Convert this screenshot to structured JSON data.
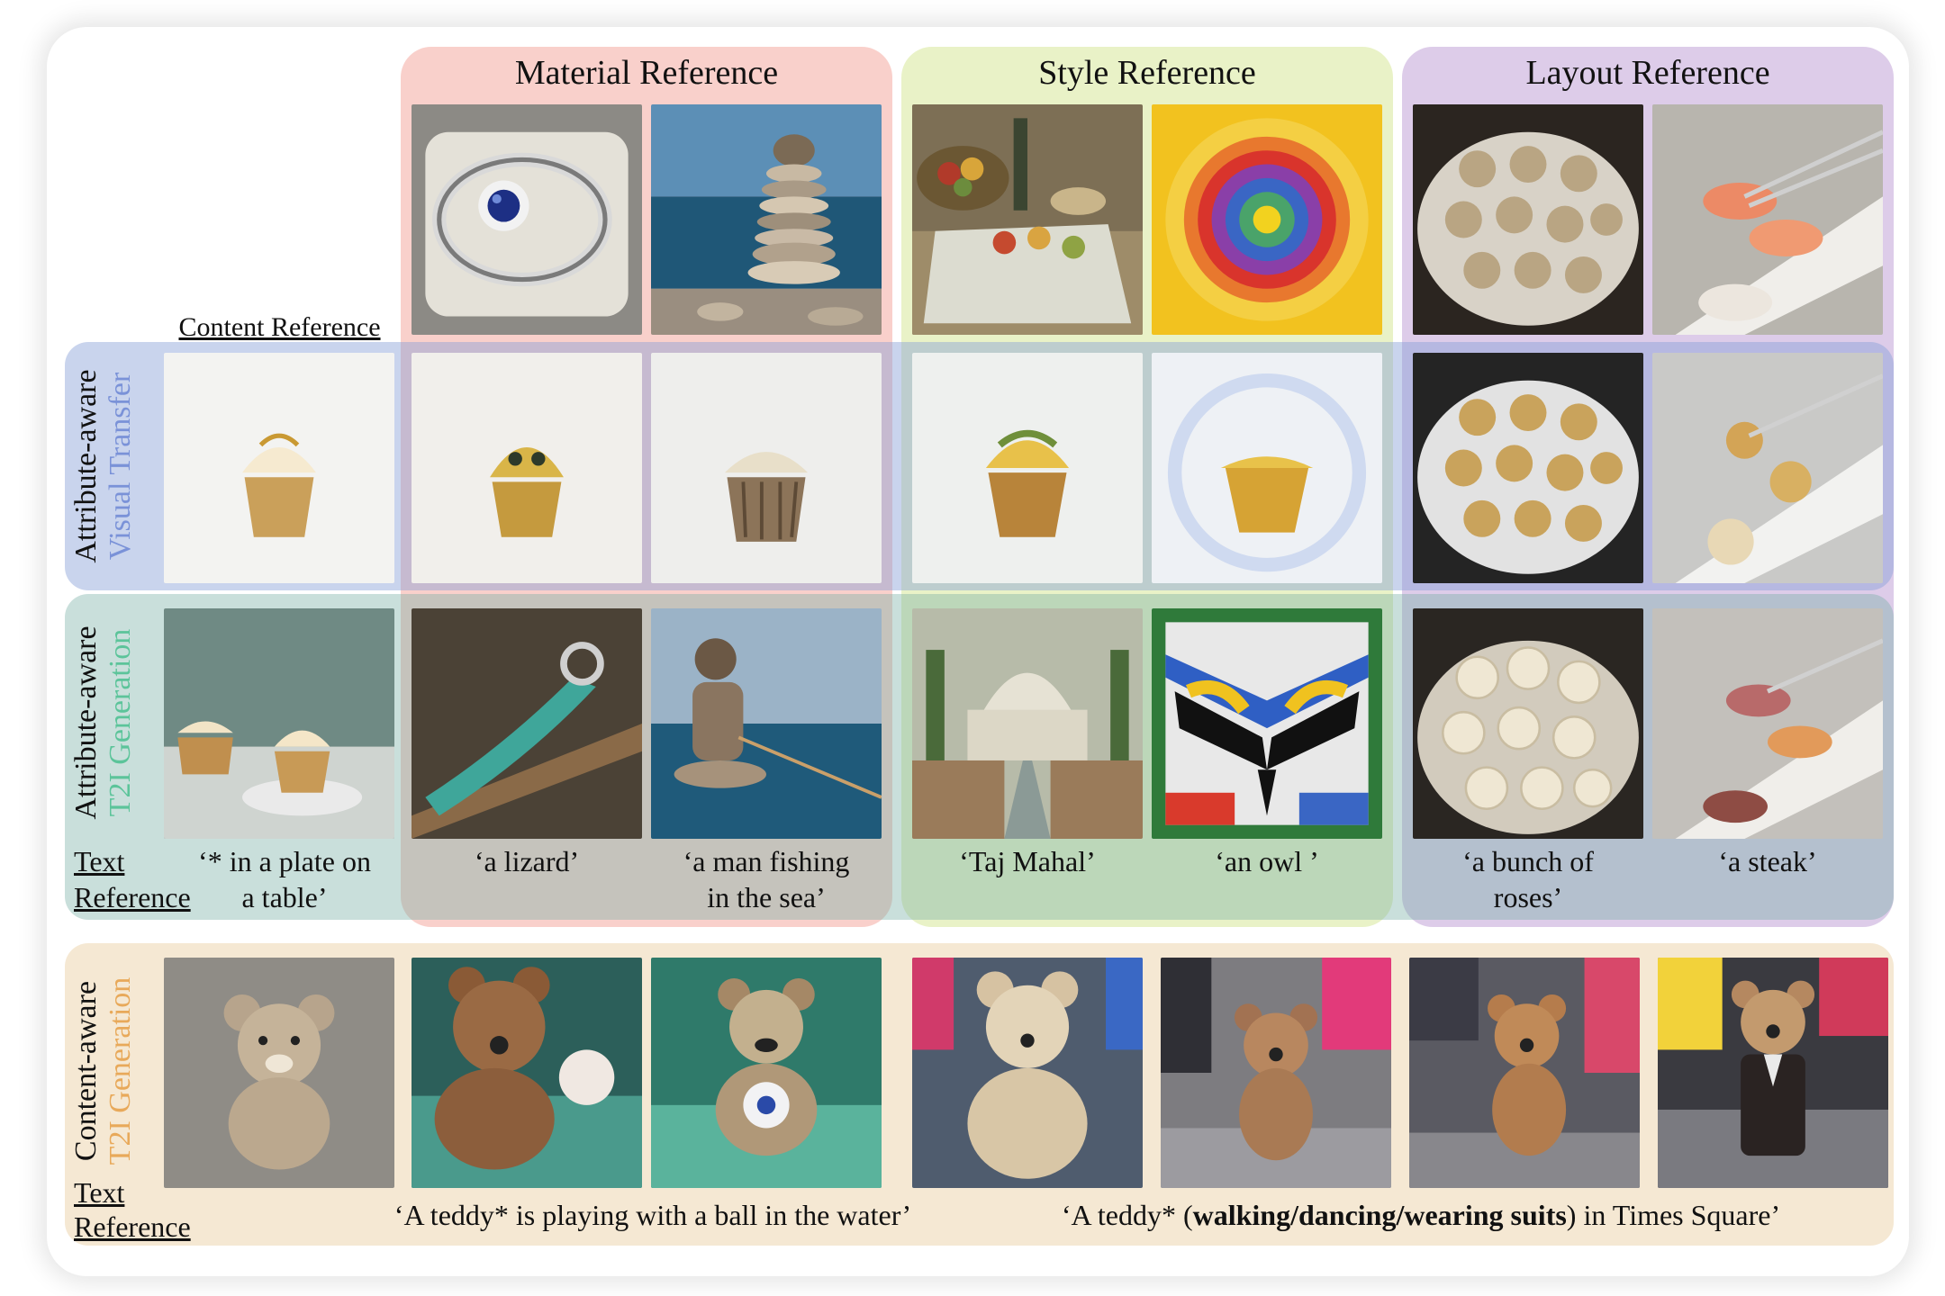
{
  "columns": {
    "material": "Material Reference",
    "style": "Style Reference",
    "layout": "Layout Reference"
  },
  "content_reference_label": "Content Reference",
  "rows": {
    "visual_transfer": {
      "line1": "Attribute-aware",
      "line2": "Visual Transfer",
      "line2_color": "#7a92d8"
    },
    "t2i_generation": {
      "line1": "Attribute-aware",
      "line2": "T2I Generation",
      "line2_color": "#5cc49a"
    },
    "content_aware": {
      "line1": "Content-aware",
      "line2": "T2I Generation",
      "line2_color": "#e8a95a"
    }
  },
  "text_reference": {
    "line1": "Text",
    "line2": "Reference"
  },
  "t2i_captions": {
    "content": {
      "line1": "‘* in a plate on",
      "line2": "a table’"
    },
    "lizard": "‘a lizard’",
    "fishing": {
      "line1": "‘a man fishing",
      "line2": "in the sea’"
    },
    "taj": "‘Taj Mahal’",
    "owl": "‘an owl ’",
    "roses": {
      "line1": "‘a bunch of",
      "line2": "roses’"
    },
    "steak": "‘a steak’"
  },
  "bottom_captions": {
    "water": "‘A teddy* is playing with a ball in the water’",
    "times_prefix": "‘A teddy* (",
    "times_bold": "walking/dancing/wearing suits",
    "times_suffix": ") in Times Square’"
  },
  "colors": {
    "material_band": "#f4aaa0",
    "style_band": "#e2eeb4",
    "layout_band": "#ceb6e0",
    "visual_row": "#87a0d7",
    "t2i_row": "#78afa5",
    "content_row": "#f2e2c8"
  }
}
